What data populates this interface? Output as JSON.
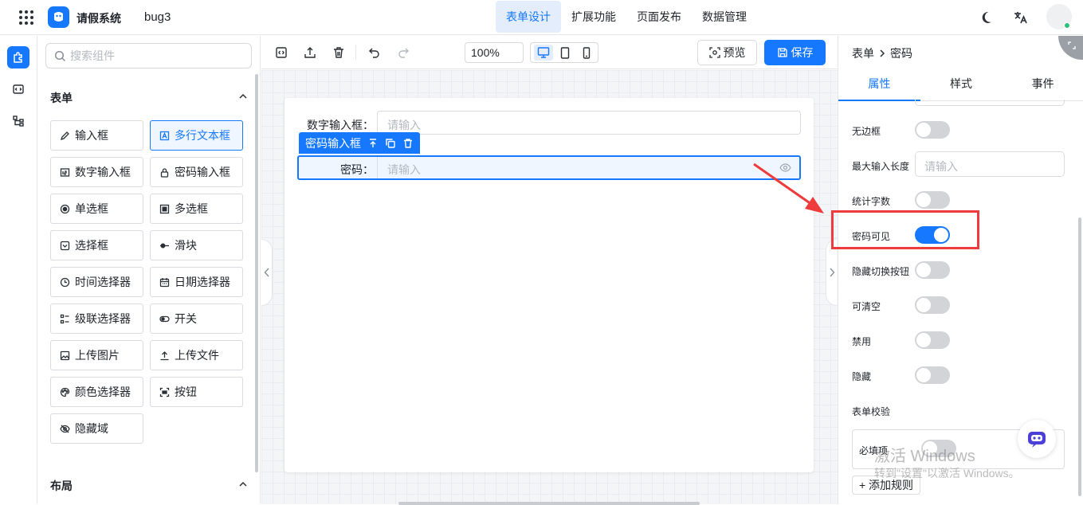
{
  "header": {
    "app_name": "请假系统",
    "form_name": "bug3",
    "nav": [
      {
        "label": "表单设计",
        "active": true
      },
      {
        "label": "扩展功能",
        "active": false
      },
      {
        "label": "页面发布",
        "active": false
      },
      {
        "label": "数据管理",
        "active": false
      }
    ],
    "accent_color": "#1677ff"
  },
  "components_panel": {
    "search_placeholder": "搜索组件",
    "form_group_title": "表单",
    "items": [
      {
        "label": "输入框",
        "icon": "pencil-icon"
      },
      {
        "label": "多行文本框",
        "icon": "textarea-icon",
        "selected": true
      },
      {
        "label": "数字输入框",
        "icon": "number-input-icon"
      },
      {
        "label": "密码输入框",
        "icon": "lock-icon"
      },
      {
        "label": "单选框",
        "icon": "radio-icon"
      },
      {
        "label": "多选框",
        "icon": "checkbox-icon"
      },
      {
        "label": "选择框",
        "icon": "select-icon"
      },
      {
        "label": "滑块",
        "icon": "slider-icon"
      },
      {
        "label": "时间选择器",
        "icon": "clock-icon"
      },
      {
        "label": "日期选择器",
        "icon": "calendar-icon"
      },
      {
        "label": "级联选择器",
        "icon": "cascader-icon"
      },
      {
        "label": "开关",
        "icon": "switch-icon"
      },
      {
        "label": "上传图片",
        "icon": "image-icon"
      },
      {
        "label": "上传文件",
        "icon": "upload-icon"
      },
      {
        "label": "颜色选择器",
        "icon": "palette-icon"
      },
      {
        "label": "按钮",
        "icon": "button-icon"
      },
      {
        "label": "隐藏域",
        "icon": "eye-off-icon"
      }
    ],
    "layout_group_title": "布局"
  },
  "toolbar": {
    "zoom": "100%",
    "preview_label": "预览",
    "save_label": "保存"
  },
  "canvas": {
    "fields": [
      {
        "label": "数字输入框：",
        "placeholder": "请输入"
      },
      {
        "label": "密码：",
        "placeholder": "请输入"
      }
    ],
    "selected_tag": "密码输入框"
  },
  "props_panel": {
    "breadcrumb": [
      "表单",
      "密码"
    ],
    "tabs": [
      {
        "label": "属性",
        "active": true
      },
      {
        "label": "样式",
        "active": false
      },
      {
        "label": "事件",
        "active": false
      }
    ],
    "rows": [
      {
        "label": "无边框",
        "type": "switch",
        "on": false
      },
      {
        "label": "最大输入长度",
        "type": "input",
        "placeholder": "请输入"
      },
      {
        "label": "统计字数",
        "type": "switch",
        "on": false
      },
      {
        "label": "密码可见",
        "type": "switch",
        "on": true
      },
      {
        "label": "隐藏切换按钮",
        "type": "switch",
        "on": false
      },
      {
        "label": "可清空",
        "type": "switch",
        "on": false
      },
      {
        "label": "禁用",
        "type": "switch",
        "on": false
      },
      {
        "label": "隐藏",
        "type": "switch",
        "on": false
      }
    ],
    "validation_title": "表单校验",
    "required_label": "必填项",
    "required_on": false,
    "add_rule_label": "+ 添加规则"
  },
  "watermark": {
    "line1": "激活 Windows",
    "line2": "转到\"设置\"以激活 Windows。"
  },
  "annotation": {
    "highlight_color": "#ee3b3b"
  }
}
